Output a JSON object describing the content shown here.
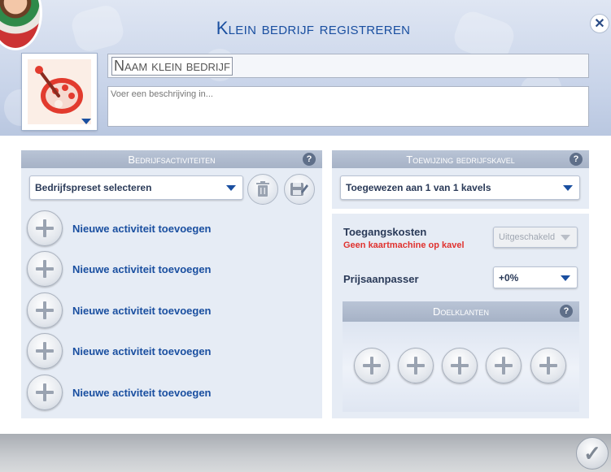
{
  "dialog": {
    "title": "Klein bedrijf registreren",
    "name_value": "Naam klein bedrijf",
    "description_placeholder": "Voer een beschrijving in..."
  },
  "activities_panel": {
    "title": "Bedrijfsactiviteiten",
    "preset_dropdown": "Bedrijfspreset selecteren",
    "activities": [
      {
        "label": "Nieuwe activiteit toevoegen"
      },
      {
        "label": "Nieuwe activiteit toevoegen"
      },
      {
        "label": "Nieuwe activiteit toevoegen"
      },
      {
        "label": "Nieuwe activiteit toevoegen"
      },
      {
        "label": "Nieuwe activiteit toevoegen"
      }
    ]
  },
  "lot_panel": {
    "title": "Toewijzing bedrijfskavel",
    "lot_dropdown": "Toegewezen aan 1 van 1 kavels",
    "entrance_label": "Toegangskosten",
    "entrance_warning": "Geen kaartmachine op kavel",
    "entrance_dropdown": "Uitgeschakeld",
    "price_label": "Prijsaanpasser",
    "price_dropdown": "+0%",
    "customers_title": "Doelklanten",
    "customer_slots": 5
  },
  "help_glyph": "?",
  "close_glyph": "✕",
  "confirm_glyph": "✓",
  "colors": {
    "accent_blue": "#1a4fa0",
    "warning_red": "#e0322f",
    "panel_header": "#a6b2c6"
  }
}
